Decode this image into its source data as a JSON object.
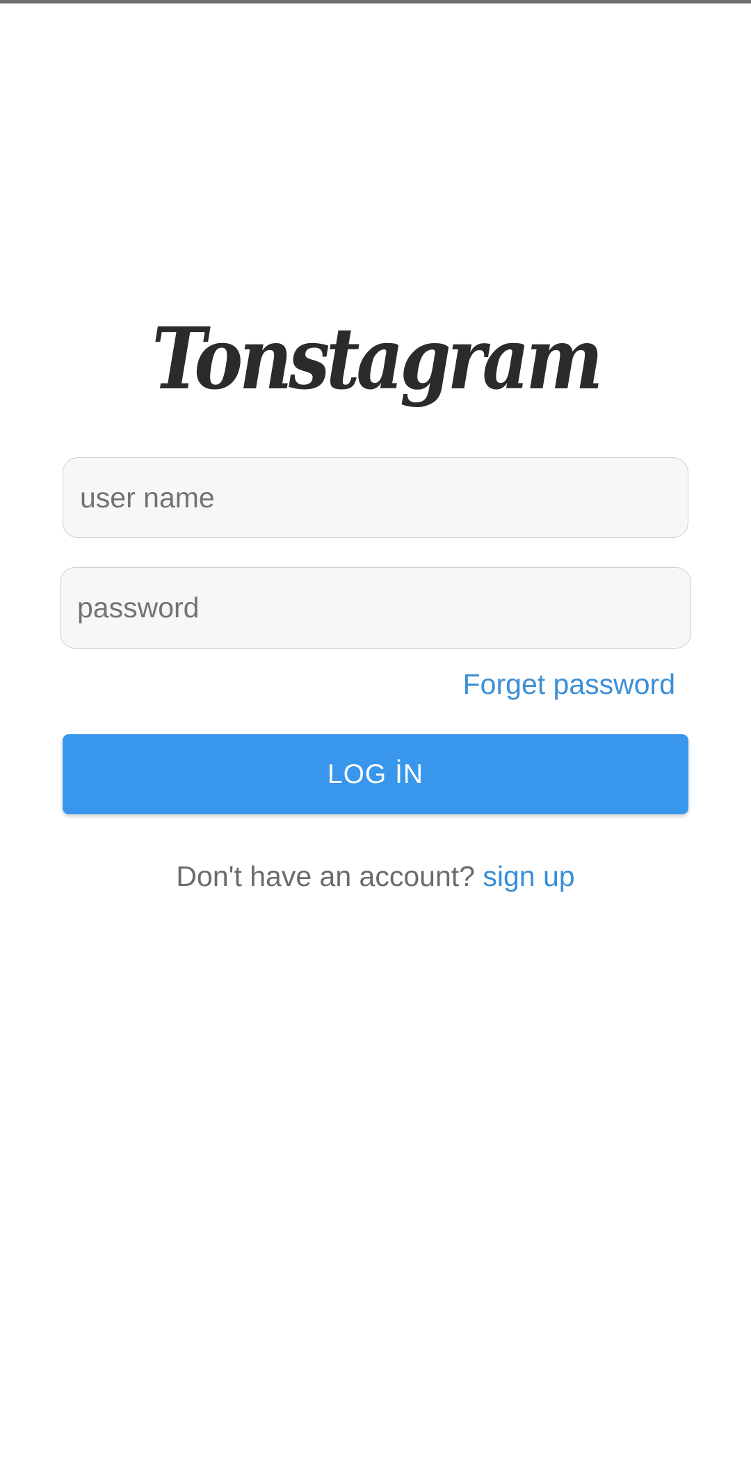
{
  "app": {
    "logo_text": "Tonstagram"
  },
  "form": {
    "username_placeholder": "user name",
    "username_value": "",
    "password_placeholder": "password",
    "password_value": "",
    "forgot_label": "Forget password",
    "login_label": "LOG İN"
  },
  "footer": {
    "prompt": "Don't have an account?",
    "signup_label": "sign up"
  },
  "colors": {
    "accent": "#3896ec",
    "link": "#3a8fd6",
    "logo": "#2b2b2b",
    "field_bg": "#f7f7f7"
  }
}
